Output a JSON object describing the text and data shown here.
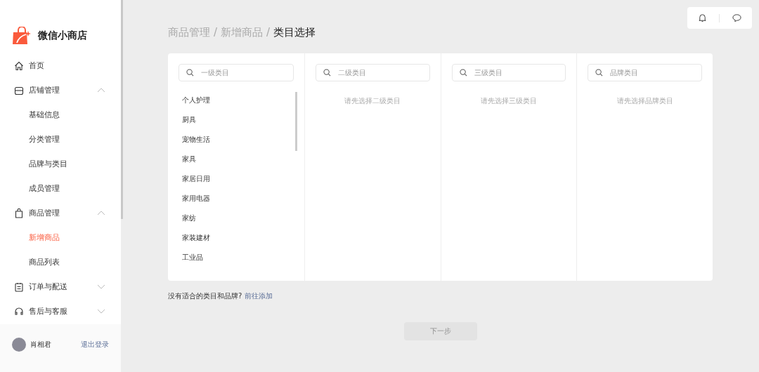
{
  "sidebar": {
    "brand": "微信小商店",
    "items": [
      {
        "label": "首页"
      },
      {
        "label": "店铺管理",
        "expanded": true,
        "children": [
          {
            "label": "基础信息",
            "selected": false
          },
          {
            "label": "分类管理",
            "selected": false
          },
          {
            "label": "品牌与类目",
            "selected": false
          },
          {
            "label": "成员管理",
            "selected": false
          }
        ]
      },
      {
        "label": "商品管理",
        "expanded": true,
        "children": [
          {
            "label": "新增商品",
            "selected": true
          },
          {
            "label": "商品列表",
            "selected": false
          }
        ]
      },
      {
        "label": "订单与配送",
        "expanded": false
      },
      {
        "label": "售后与客服",
        "expanded": false
      }
    ],
    "user": {
      "name": "肖相君",
      "logout": "退出登录"
    }
  },
  "breadcrumb_separator": "/",
  "breadcrumb": [
    {
      "label": "商品管理",
      "current": false
    },
    {
      "label": "新增商品",
      "current": false
    },
    {
      "label": "类目选择",
      "current": true
    }
  ],
  "columns": [
    {
      "placeholder": "一级类目",
      "items": [
        "个人护理",
        "厨具",
        "宠物生活",
        "家具",
        "家居日用",
        "家用电器",
        "家纺",
        "家装建材",
        "工业品"
      ]
    },
    {
      "placeholder": "二级类目",
      "empty_hint": "请先选择二级类目"
    },
    {
      "placeholder": "三级类目",
      "empty_hint": "请先选择三级类目"
    },
    {
      "placeholder": "品牌类目",
      "empty_hint": "请先选择品牌类目"
    }
  ],
  "note": {
    "text": "没有适合的类目和品牌?",
    "link": "前往添加"
  },
  "next_button": {
    "label": "下一步",
    "disabled": true
  }
}
